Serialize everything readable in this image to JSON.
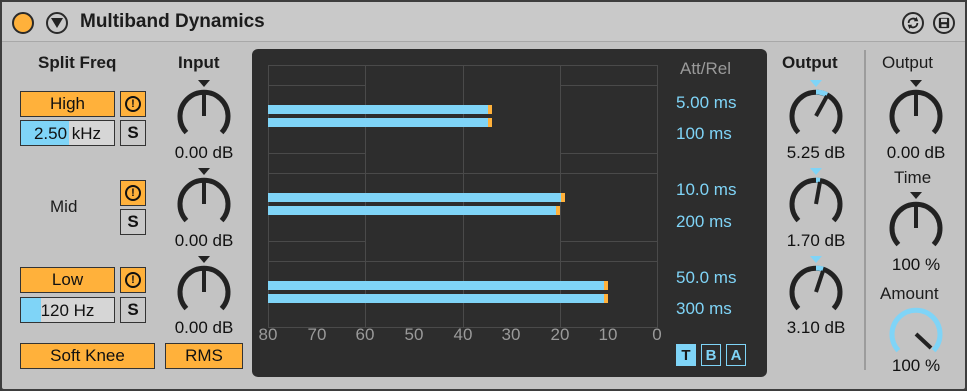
{
  "title": "Multiband Dynamics",
  "split_freq": {
    "heading": "Split Freq",
    "high": {
      "label": "High",
      "solo": "S",
      "freq": "2.50 kHz",
      "freq_fill": 0.52
    },
    "mid": {
      "label": "Mid",
      "solo": "S"
    },
    "low": {
      "label": "Low",
      "solo": "S",
      "freq": "120 Hz",
      "freq_fill": 0.22
    }
  },
  "input": {
    "heading": "Input",
    "values": [
      "0.00 dB",
      "0.00 dB",
      "0.00 dB"
    ]
  },
  "display": {
    "att_rel_heading": "Att/Rel",
    "bands": [
      {
        "attack": "5.00 ms",
        "release": "100 ms",
        "bar_top_db": 34,
        "bar_bottom_db": 34
      },
      {
        "attack": "10.0 ms",
        "release": "200 ms",
        "bar_top_db": 19,
        "bar_bottom_db": 20
      },
      {
        "attack": "50.0 ms",
        "release": "300 ms",
        "bar_top_db": 10,
        "bar_bottom_db": 10
      }
    ],
    "scale": [
      "80",
      "70",
      "60",
      "50",
      "40",
      "30",
      "20",
      "10",
      "0"
    ],
    "modes": [
      {
        "label": "T",
        "active": true
      },
      {
        "label": "B",
        "active": false
      },
      {
        "label": "A",
        "active": false
      }
    ]
  },
  "output": {
    "heading": "Output",
    "values": [
      "5.25 dB",
      "1.70 dB",
      "3.10 dB"
    ]
  },
  "global": {
    "output_heading": "Output",
    "output_value": "0.00 dB",
    "time_heading": "Time",
    "time_value": "100 %",
    "amount_heading": "Amount",
    "amount_value": "100 %"
  },
  "soft_knee": "Soft Knee",
  "rms": "RMS",
  "colors": {
    "accent_orange": "#ffb13b",
    "accent_blue": "#7fd4f7",
    "panel": "#c3c3c3",
    "display_bg": "#2d2d2d"
  }
}
